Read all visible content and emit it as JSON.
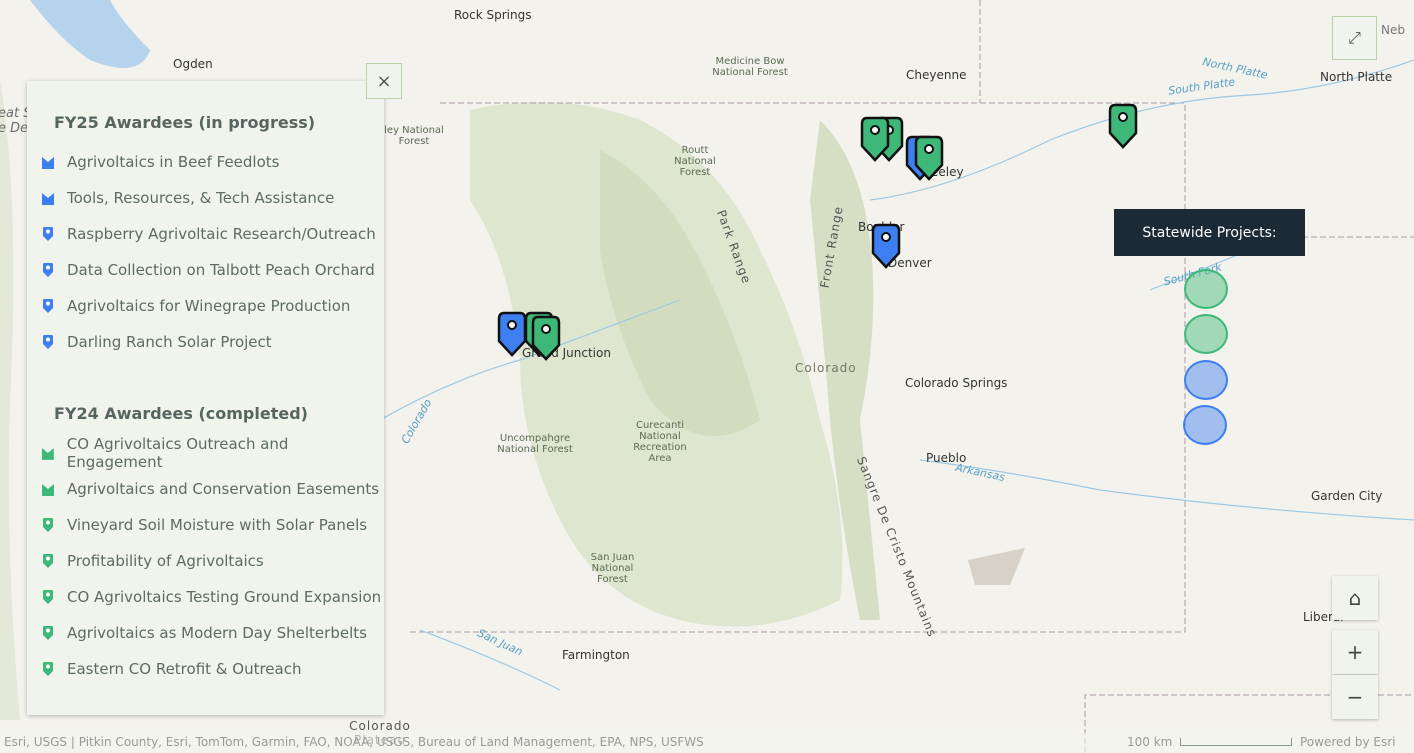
{
  "map": {
    "labels": {
      "rock_springs": "Rock Springs",
      "ogden": "Ogden",
      "medicine_bow": "Medicine Bow National Forest",
      "cheyenne": "Cheyenne",
      "north_platte_river": "North Platte",
      "north_platte_city": "North Platte",
      "south_platte": "South Platte",
      "routt": "Routt National Forest",
      "ashley": "ley National Forest",
      "greeley": "Greeley",
      "boulder": "Boulder",
      "denver": "Denver",
      "park_range": "Park Range",
      "front_range": "Front Range",
      "colorado": "Colorado",
      "colorado_springs": "Colorado Springs",
      "grand_junction": "Grand Junction",
      "uncompahgre": "Uncompahgre National Forest",
      "curecanti": "Curecanti National Recreation Area",
      "pueblo": "Pueblo",
      "arkansas": "Arkansas",
      "sangre": "Sangre De Cristo Mountains",
      "san_juan_nf": "San Juan National Forest",
      "farmington": "Farmington",
      "san_juan_river": "San Juan",
      "colorado_plateau": "Colorado Plateau",
      "garden_city": "Garden City",
      "liberal": "Liberal",
      "south_fork": "South Fork",
      "nebraska": "Neb",
      "colorado_river": "Colorado",
      "great_salt": "eat S\ne De"
    },
    "pin_colors": {
      "fy25": "#3d7ff0",
      "fy24": "#3db878"
    }
  },
  "legend": {
    "close_icon": "close-icon",
    "sections": [
      {
        "title": "FY25 Awardees (in progress)",
        "items": [
          {
            "label": "Agrivoltaics in Beef Feedlots",
            "icon": "area"
          },
          {
            "label": "Tools, Resources, & Tech Assistance",
            "icon": "area"
          },
          {
            "label": "Raspberry Agrivoltaic Research/Outreach",
            "icon": "pin"
          },
          {
            "label": "Data Collection on Talbott Peach Orchard",
            "icon": "pin"
          },
          {
            "label": "Agrivoltaics for Winegrape Production",
            "icon": "pin"
          },
          {
            "label": "Darling Ranch Solar Project",
            "icon": "pin"
          }
        ]
      },
      {
        "title": "FY24 Awardees (completed)",
        "items": [
          {
            "label": "CO Agrivoltaics Outreach and Engagement",
            "icon": "area"
          },
          {
            "label": "Agrivoltaics and Conservation Easements",
            "icon": "area"
          },
          {
            "label": "Vineyard Soil Moisture with Solar Panels",
            "icon": "pin"
          },
          {
            "label": "Profitability of Agrivoltaics",
            "icon": "pin"
          },
          {
            "label": "CO Agrivoltaics Testing Ground Expansion",
            "icon": "pin"
          },
          {
            "label": "Agrivoltaics as Modern Day Shelterbelts",
            "icon": "pin"
          },
          {
            "label": "Eastern CO Retrofit & Outreach",
            "icon": "pin"
          }
        ]
      }
    ]
  },
  "tooltip": {
    "title": "Statewide Projects:"
  },
  "controls": {
    "home": "⌂",
    "zoom_in": "+",
    "zoom_out": "−",
    "expand": "⤢"
  },
  "footer": {
    "attribution": "Esri, USGS | Pitkin County, Esri, TomTom, Garmin, FAO, NOAA, USGS, Bureau of Land Management, EPA, NPS, USFWS",
    "scale": "100 km",
    "powered": "Powered by Esri"
  }
}
